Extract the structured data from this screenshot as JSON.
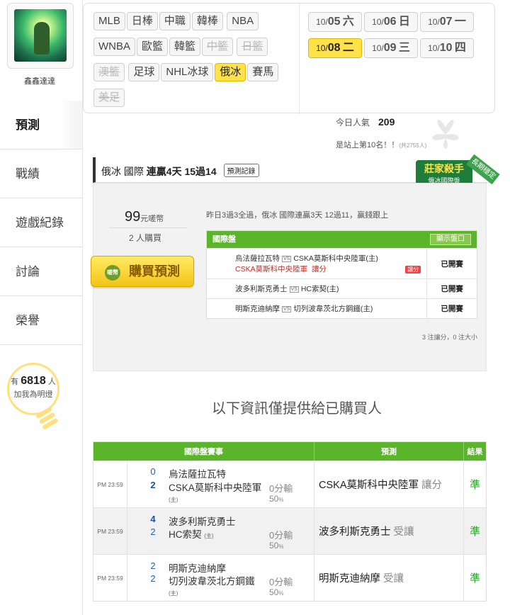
{
  "user": {
    "name": "鑫鑫達達"
  },
  "nav": [
    {
      "label": "預測",
      "active": true
    },
    {
      "label": "戰績"
    },
    {
      "label": "遊戲紀錄"
    },
    {
      "label": "討論"
    },
    {
      "label": "榮譽"
    }
  ],
  "bulb": {
    "prefix": "有",
    "count": "6818",
    "suffix": "人",
    "text": "加我為明燈"
  },
  "sports": [
    {
      "label": "MLB"
    },
    {
      "label": "日棒"
    },
    {
      "label": "中職"
    },
    {
      "label": "韓棒"
    },
    {
      "label": "NBA"
    },
    {
      "label": "WNBA"
    },
    {
      "label": "歐籃"
    },
    {
      "label": "韓籃"
    },
    {
      "label": "中籃",
      "disabled": true
    },
    {
      "label": "日籃",
      "disabled": true
    },
    {
      "label": "澳籃",
      "disabled": true
    },
    {
      "label": "足球"
    },
    {
      "label": "NHL冰球"
    },
    {
      "label": "俄冰",
      "active": true
    },
    {
      "label": "賽馬"
    },
    {
      "label": "美足",
      "disabled": true
    }
  ],
  "dates": [
    {
      "prefix": "10/",
      "day": "05",
      "weekday": "六"
    },
    {
      "prefix": "10/",
      "day": "06",
      "weekday": "日"
    },
    {
      "prefix": "10/",
      "day": "07",
      "weekday": "一"
    },
    {
      "prefix": "10/",
      "day": "08",
      "weekday": "二",
      "active": true
    },
    {
      "prefix": "10/",
      "day": "09",
      "weekday": "三"
    },
    {
      "prefix": "10/",
      "day": "10",
      "weekday": "四"
    }
  ],
  "popularity": {
    "label": "今日人氣",
    "value": "209"
  },
  "rank": {
    "text": "是站上第10名！！",
    "note": "(共2755人)"
  },
  "prediction": {
    "title_prefix": "俄冰 國際",
    "title_bold": "連贏4天 15過14",
    "record_btn": "預測記錄",
    "badge_main": "莊家殺手",
    "badge_sub": "俄冰國際盤",
    "badge_ribbon": "長期穩定",
    "price": "99",
    "price_unit": "元嗟幣",
    "buyers": "2 人購買",
    "buy_icon": "嗟幣",
    "buy_label": "購買預測",
    "summary": "昨日3過3全過，俄冰 國際連贏3天 12過11，贏錢跟上",
    "table_title": "國際盤",
    "show_btn": "顯示盤口",
    "bet_tag": "讓分",
    "handicap_note": "讓分",
    "footer_note": "3 注讓分，0 注大小",
    "matches": [
      {
        "home": "烏法薩拉瓦特",
        "away": "CSKA莫斯科中央陸軍(主)",
        "pick": "CSKA莫斯科中央陸軍",
        "status": "已開賽"
      },
      {
        "home": "波多利斯克勇士",
        "away": "HC索契(主)",
        "status": "已開賽"
      },
      {
        "home": "明斯克迪納摩",
        "away": "切列波韋茨北方鋼鐵(主)",
        "status": "已開賽"
      }
    ]
  },
  "info_title": "以下資訊僅提供給已購買人",
  "results": {
    "headers": [
      "國際盤賽事",
      "預測",
      "結果"
    ],
    "rows": [
      {
        "time": "PM 23:59",
        "s1": "0",
        "s2": "2",
        "t1": "烏法薩拉瓦特",
        "t2": "CSKA莫斯科中央陸軍",
        "host": "(主)",
        "line": "0分輸",
        "pct": "50",
        "pct_unit": "%",
        "pick": "CSKA莫斯科中央陸軍",
        "pick_sub": "讓分",
        "result": "準"
      },
      {
        "time": "PM 23:59",
        "s1": "4",
        "s2": "2",
        "t1": "波多利斯克勇士",
        "t2": "HC索契",
        "host": "(主)",
        "line": "0分輸",
        "pct": "50",
        "pct_unit": "%",
        "pick": "波多利斯克勇士",
        "pick_sub": "受讓",
        "result": "準"
      },
      {
        "time": "PM 23:59",
        "s1": "2",
        "s2": "2",
        "t1": "明斯克迪納摩",
        "t2": "切列波韋茨北方鋼鐵",
        "host": "(主)",
        "line": "0分輸",
        "pct": "50",
        "pct_unit": "%",
        "pick": "明斯克迪納摩",
        "pick_sub": "受讓",
        "result": "準"
      }
    ]
  }
}
